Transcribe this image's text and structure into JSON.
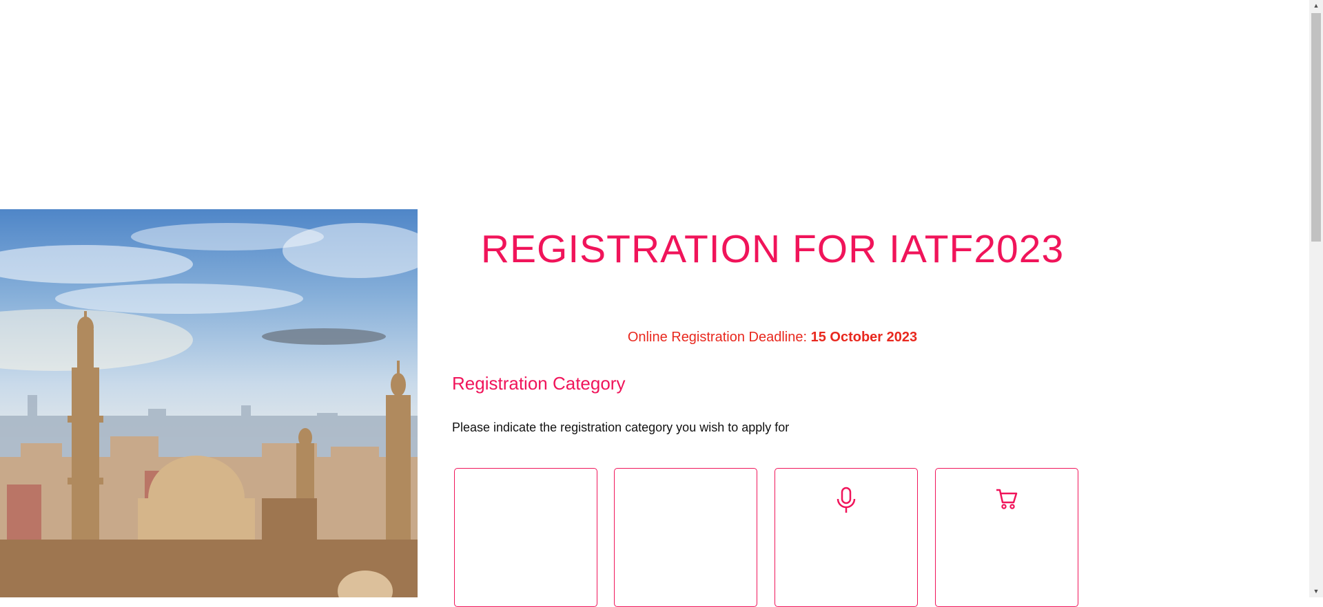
{
  "hero": {
    "image_alt": "Cairo skyline with mosque domes and minarets"
  },
  "header": {
    "title": "REGISTRATION FOR IATF2023"
  },
  "deadline": {
    "label": "Online Registration Deadline:",
    "date": "15 October 2023"
  },
  "section": {
    "title": "Registration Category",
    "instruction": "Please indicate the registration category you wish to apply for"
  },
  "cards": [
    {
      "icon": ""
    },
    {
      "icon": ""
    },
    {
      "icon": "microphone-icon"
    },
    {
      "icon": "shopping-cart-icon"
    }
  ],
  "colors": {
    "accent": "#f0145a",
    "deadline": "#e8281e"
  }
}
